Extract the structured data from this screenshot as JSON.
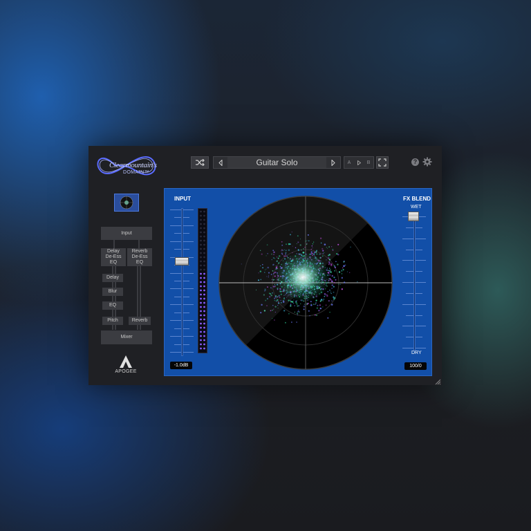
{
  "header": {
    "logo_line1": "Clearmountain's",
    "logo_line2": "DOMAIN™",
    "preset_name": "Guitar Solo",
    "ab_a": "A",
    "ab_b": "B",
    "help_label": "?"
  },
  "signal_chain": {
    "input": "Input",
    "left_fx": "Delay\nDe-Ess\nEQ",
    "right_fx": "Reverb\nDe-Ess\nEQ",
    "delay": "Delay",
    "blur": "Blur",
    "eq": "EQ",
    "pitch": "Pitch",
    "reverb": "Reverb",
    "mixer": "Mixer"
  },
  "brand": {
    "label": "APOGEE"
  },
  "input_section": {
    "label": "INPUT",
    "readout": "-1.0dB"
  },
  "fx_blend": {
    "label": "FX BLEND",
    "top_label": "WET",
    "bottom_label": "DRY",
    "readout": "100/0"
  },
  "meter": {
    "lit_fraction": 0.55
  },
  "icons": [
    "shuffle-icon",
    "arrow-left-icon",
    "arrow-right-icon",
    "expand-icon",
    "help-icon",
    "gear-icon",
    "apogee-logo-icon",
    "resize-grip-icon"
  ],
  "colors": {
    "panel_blue": "#124fa8",
    "window_bg": "#1f2024",
    "meter_purple": "#8a5cff"
  }
}
